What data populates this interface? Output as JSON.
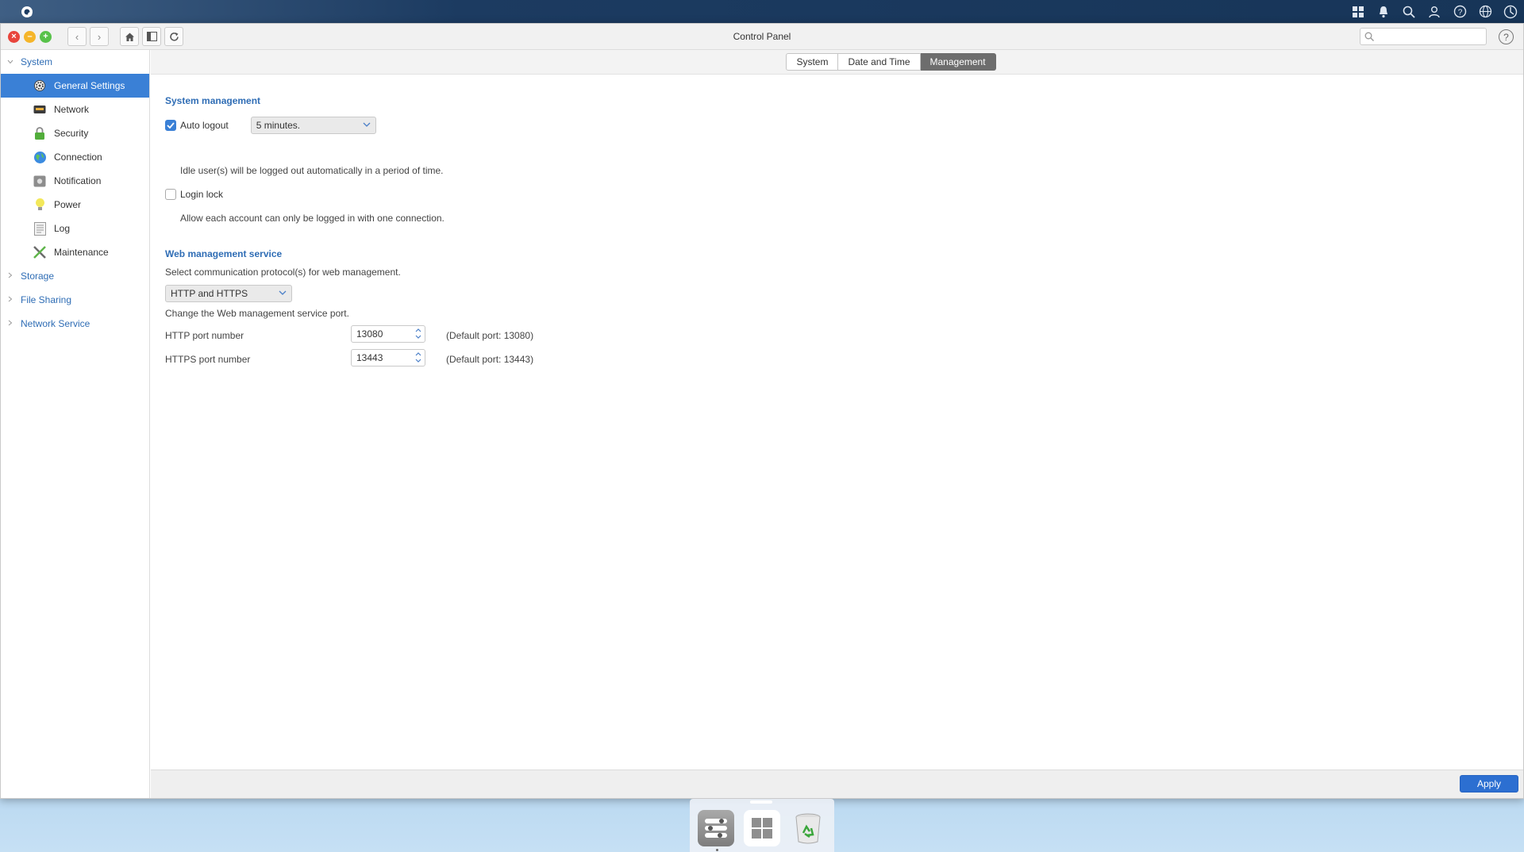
{
  "window": {
    "title": "Control Panel",
    "search_placeholder": ""
  },
  "sidebar": {
    "groups": [
      {
        "label": "System",
        "expanded": true
      },
      {
        "label": "Storage",
        "expanded": false
      },
      {
        "label": "File Sharing",
        "expanded": false
      },
      {
        "label": "Network Service",
        "expanded": false
      }
    ],
    "items": [
      {
        "label": "General Settings",
        "icon": "gear-icon",
        "active": true
      },
      {
        "label": "Network",
        "icon": "network-icon"
      },
      {
        "label": "Security",
        "icon": "lock-icon"
      },
      {
        "label": "Connection",
        "icon": "globe-icon"
      },
      {
        "label": "Notification",
        "icon": "notification-icon"
      },
      {
        "label": "Power",
        "icon": "bulb-icon"
      },
      {
        "label": "Log",
        "icon": "log-icon"
      },
      {
        "label": "Maintenance",
        "icon": "tools-icon"
      }
    ]
  },
  "tabs": [
    {
      "label": "System"
    },
    {
      "label": "Date and Time"
    },
    {
      "label": "Management",
      "active": true
    }
  ],
  "system_management": {
    "title": "System management",
    "auto_logout": {
      "label": "Auto logout",
      "checked": true,
      "value": "5 minutes.",
      "desc": "Idle user(s) will be logged out automatically in a period of time."
    },
    "login_lock": {
      "label": "Login lock",
      "checked": false,
      "desc": "Allow each account can only be logged in with one connection."
    }
  },
  "web_management": {
    "title": "Web management service",
    "protocol_desc": "Select communication protocol(s) for web management.",
    "protocol_value": "HTTP and HTTPS",
    "port_desc": "Change the Web management service port.",
    "http": {
      "label": "HTTP port number",
      "value": "13080",
      "default": "(Default port: 13080)"
    },
    "https": {
      "label": "HTTPS port number",
      "value": "13443",
      "default": "(Default port: 13443)"
    }
  },
  "footer": {
    "apply_label": "Apply"
  },
  "colors": {
    "accent": "#3a80d6",
    "section_title": "#2f6db5",
    "apply": "#2c6fd1"
  }
}
